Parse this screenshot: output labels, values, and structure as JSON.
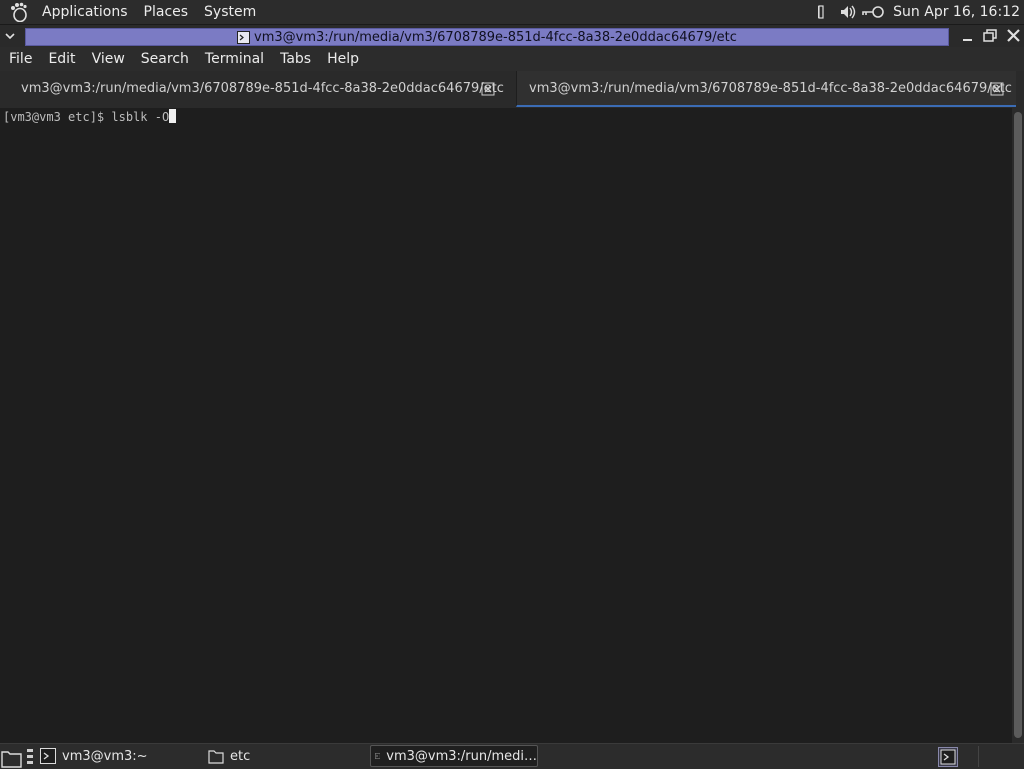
{
  "top_panel": {
    "menus": [
      "Applications",
      "Places",
      "System"
    ],
    "clock": "Sun Apr 16, 16:12"
  },
  "window": {
    "title": "vm3@vm3:/run/media/vm3/6708789e-851d-4fcc-8a38-2e0ddac64679/etc"
  },
  "menubar": {
    "items": [
      "File",
      "Edit",
      "View",
      "Search",
      "Terminal",
      "Tabs",
      "Help"
    ]
  },
  "tabs": [
    {
      "label": "vm3@vm3:/run/media/vm3/6708789e-851d-4fcc-8a38-2e0ddac64679/etc",
      "active": false
    },
    {
      "label": "vm3@vm3:/run/media/vm3/6708789e-851d-4fcc-8a38-2e0ddac64679/etc",
      "active": true
    }
  ],
  "terminal": {
    "prompt": "[vm3@vm3 etc]$ ",
    "command": "lsblk -O"
  },
  "taskbar": {
    "items": [
      {
        "label": "vm3@vm3:~",
        "icon": "terminal-icon"
      },
      {
        "label": "etc",
        "icon": "folder-icon"
      },
      {
        "label": "vm3@vm3:/run/medi…",
        "icon": "terminal-icon"
      }
    ]
  },
  "colors": {
    "title_strip": "#7b7bc4",
    "active_tab_underline": "#3b6cb5",
    "terminal_bg": "#1e1e1e"
  }
}
